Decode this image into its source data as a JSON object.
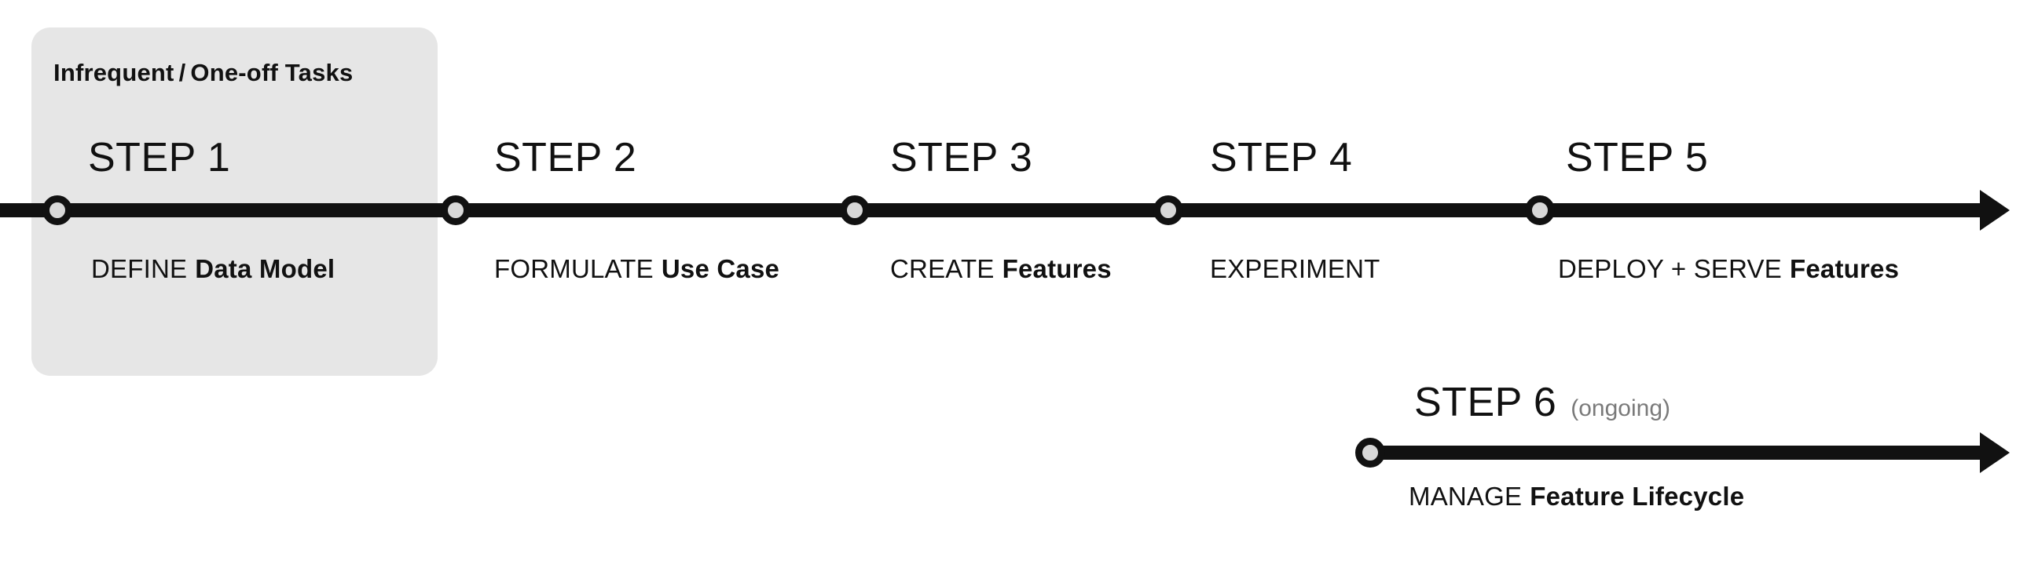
{
  "diagram": {
    "highlight_panel": {
      "caption_left": "Infrequent",
      "caption_separator": "/",
      "caption_right": "One-off Tasks",
      "background_color": "#e6e6e6"
    },
    "colors": {
      "line": "#111111",
      "node_fill": "#d8d8d8",
      "panel": "#e6e6e6",
      "note_text": "#7a7a7a",
      "page_background": "#ffffff"
    },
    "main_track": {
      "steps": [
        {
          "title": "STEP 1",
          "sub_plain": "DEFINE",
          "sub_strong": "Data Model",
          "note": ""
        },
        {
          "title": "STEP 2",
          "sub_plain": "FORMULATE",
          "sub_strong": "Use Case",
          "note": ""
        },
        {
          "title": "STEP 3",
          "sub_plain": "CREATE",
          "sub_strong": "Features",
          "note": ""
        },
        {
          "title": "STEP 4",
          "sub_plain": "EXPERIMENT",
          "sub_strong": "",
          "note": ""
        },
        {
          "title": "STEP 5",
          "sub_plain": "DEPLOY  + SERVE",
          "sub_strong": "Features",
          "note": ""
        }
      ]
    },
    "ongoing_track": {
      "steps": [
        {
          "title": "STEP 6",
          "note": "(ongoing)",
          "sub_plain": "MANAGE",
          "sub_strong": "Feature Lifecycle"
        }
      ]
    }
  }
}
